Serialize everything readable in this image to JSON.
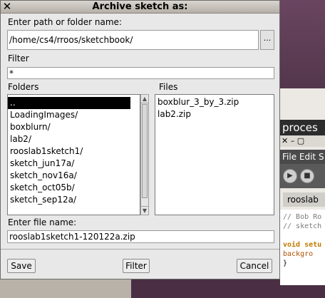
{
  "dialog": {
    "title": "Archive sketch as:",
    "close_glyph": "✕",
    "path_label": "Enter path or folder name:",
    "path_value": "/home/cs4/rroos/sketchbook/",
    "browse_label": "...",
    "filter_label": "Filter",
    "filter_value": "*",
    "folders_label": "Folders",
    "files_label": "Files",
    "folders": [
      "..",
      "LoadingImages/",
      "boxblurn/",
      "lab2/",
      "rooslab1sketch1/",
      "sketch_jun17a/",
      "sketch_nov16a/",
      "sketch_oct05b/",
      "sketch_sep12a/"
    ],
    "selected_folder": "..",
    "files": [
      "boxblur_3_by_3.zip",
      "lab2.zip"
    ],
    "filename_label": "Enter file name:",
    "filename_value": "rooslab1sketch1-120122a.zip",
    "buttons": {
      "save": "Save",
      "filter": "Filter",
      "cancel": "Cancel"
    }
  },
  "background_ide": {
    "title": "proces",
    "window_buttons": "✕ – ▢",
    "menu": "File Edit S",
    "tab": "rooslab",
    "code": [
      "// Bob Ro",
      "// sketch",
      "",
      "void setu",
      "  backgro",
      "}"
    ]
  },
  "colors": {
    "dialog_bg": "#e8e8e8",
    "selection": "#000000",
    "desktop": "#3f2a3b"
  }
}
